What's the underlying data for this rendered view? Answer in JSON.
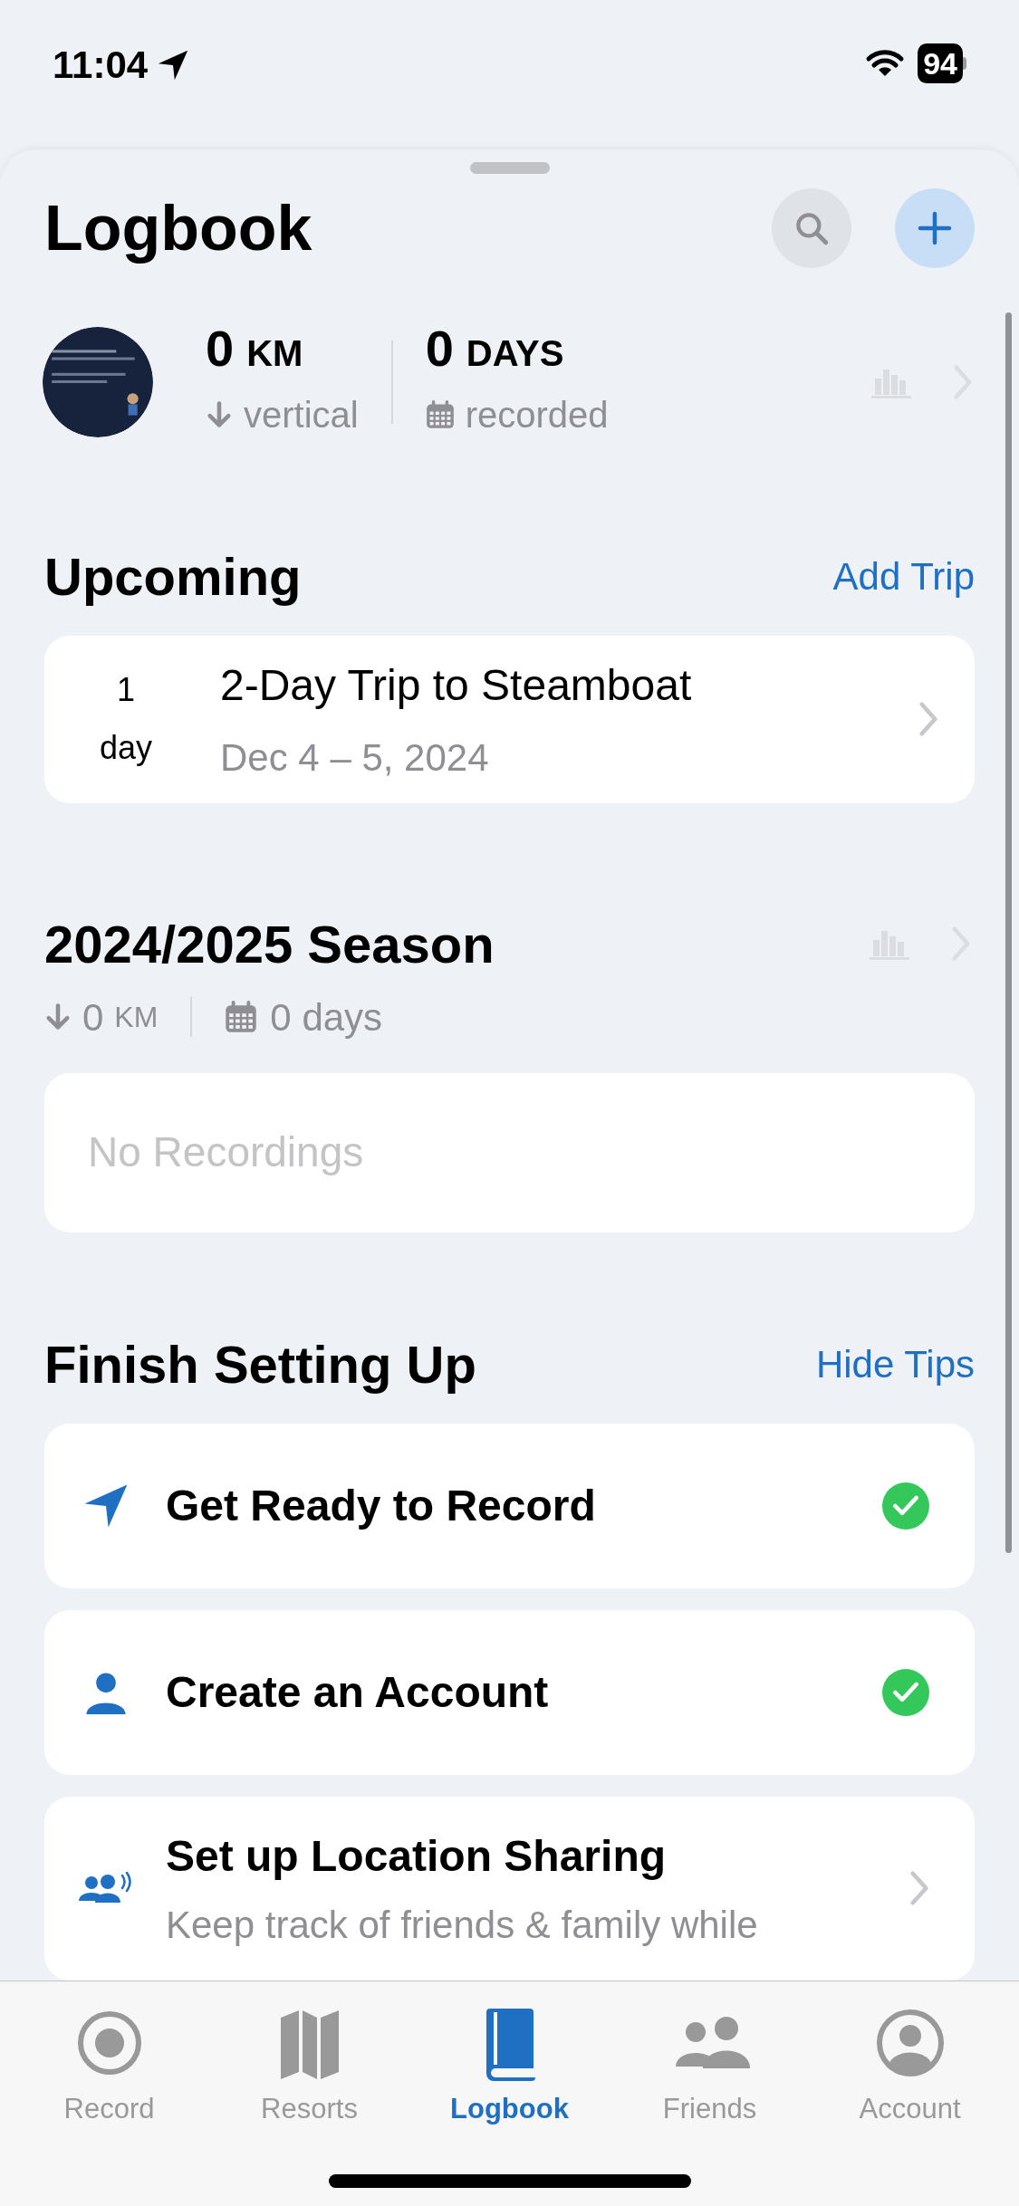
{
  "status_bar": {
    "time": "11:04",
    "battery": "94"
  },
  "header": {
    "title": "Logbook"
  },
  "summary": {
    "distance": {
      "value": "0",
      "unit": "KM",
      "label": "vertical"
    },
    "days": {
      "value": "0",
      "unit": "DAYS",
      "label": "recorded"
    }
  },
  "upcoming": {
    "title": "Upcoming",
    "action": "Add Trip",
    "trips": [
      {
        "count": "1",
        "count_unit": "day",
        "name": "2-Day Trip to Steamboat",
        "dates": "Dec 4 – 5, 2024"
      }
    ]
  },
  "season": {
    "title": "2024/2025 Season",
    "distance": "0",
    "distance_unit": "KM",
    "days": "0 days",
    "empty_text": "No Recordings"
  },
  "setup": {
    "title": "Finish Setting Up",
    "action": "Hide Tips",
    "tips": [
      {
        "kind": "location",
        "title": "Get Ready to Record",
        "completed": true
      },
      {
        "kind": "account",
        "title": "Create an Account",
        "completed": true
      },
      {
        "kind": "sharing",
        "title": "Set up Location Sharing",
        "description": "Keep track of friends & family while",
        "completed": false
      }
    ]
  },
  "tab_bar": [
    {
      "kind": "record",
      "label": "Record",
      "selected": false
    },
    {
      "kind": "resorts",
      "label": "Resorts",
      "selected": false
    },
    {
      "kind": "logbook",
      "label": "Logbook",
      "selected": true
    },
    {
      "kind": "friends",
      "label": "Friends",
      "selected": false
    },
    {
      "kind": "account",
      "label": "Account",
      "selected": false
    }
  ]
}
